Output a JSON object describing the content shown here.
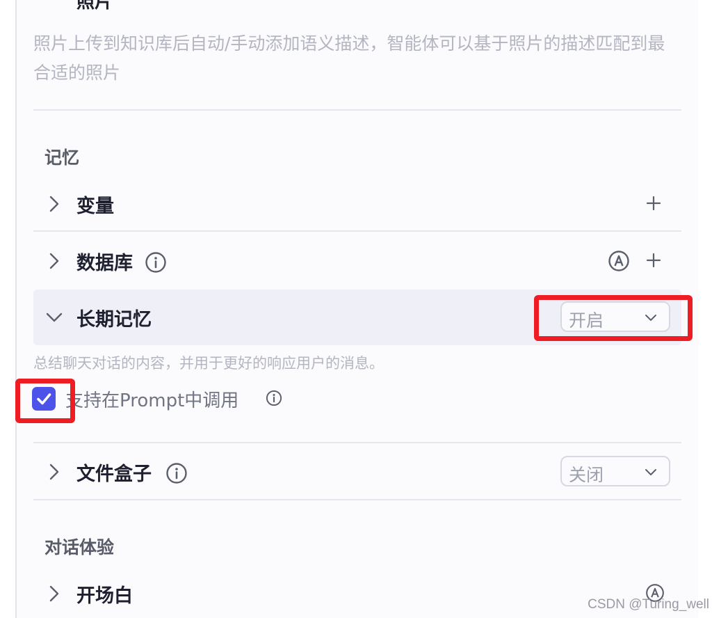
{
  "photo": {
    "title_partial": "照片",
    "description": "照片上传到知识库后自动/手动添加语义描述，智能体可以基于照片的描述匹配到最合适的照片"
  },
  "memory": {
    "section_title": "记忆",
    "variables": {
      "label": "变量"
    },
    "database": {
      "label": "数据库"
    },
    "long_term_memory": {
      "label": "长期记忆",
      "select_value": "开启",
      "description": "总结聊天对话的内容，并用于更好的响应用户的消息。",
      "prompt_checkbox_label": "支持在Prompt中调用",
      "prompt_checkbox_checked": true
    },
    "file_box": {
      "label": "文件盒子",
      "select_value": "关闭"
    }
  },
  "dialog_experience": {
    "section_title": "对话体验",
    "opening": {
      "label": "开场白"
    }
  },
  "watermark": "CSDN @Turing_well",
  "colors": {
    "accent": "#4d53e8",
    "annotation_red": "#ee1d23",
    "muted_text": "#b3b5c0",
    "expanded_row_bg": "#eeeff7"
  },
  "icons": {
    "collapsed": "chevron-right-icon",
    "expanded": "chevron-down-icon",
    "info": "info-icon",
    "add": "plus-icon",
    "auto": "circled-a-icon",
    "checkbox": "checkmark-icon"
  }
}
